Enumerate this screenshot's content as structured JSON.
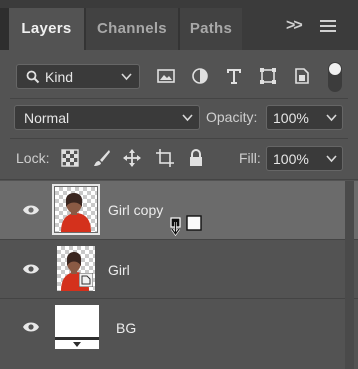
{
  "tabs": [
    {
      "label": "Layers",
      "active": true
    },
    {
      "label": "Channels",
      "active": false
    },
    {
      "label": "Paths",
      "active": false
    }
  ],
  "tabbar": {
    "overflow_icon": "double-chevron-right-icon",
    "menu_icon": "hamburger-menu-icon"
  },
  "filter": {
    "kind_label": "Kind",
    "icons": [
      "image-filter-icon",
      "adjustment-filter-icon",
      "type-filter-icon",
      "shape-filter-icon",
      "smart-object-filter-icon"
    ],
    "toggle_on": true
  },
  "blend": {
    "mode": "Normal",
    "opacity_label": "Opacity:",
    "opacity_value": "100%"
  },
  "lock": {
    "label": "Lock:",
    "icons": [
      "lock-transparent-pixels-icon",
      "lock-image-pixels-icon",
      "lock-position-icon",
      "lock-artboard-icon",
      "lock-all-icon"
    ],
    "fill_label": "Fill:",
    "fill_value": "100%"
  },
  "layers": [
    {
      "name": "Girl copy",
      "visible": true,
      "selected": true
    },
    {
      "name": "Girl",
      "visible": true,
      "selected": false
    },
    {
      "name": "BG",
      "visible": true,
      "selected": false
    }
  ],
  "colors": {
    "panel": "#535353",
    "selected_row": "#6b6b6b",
    "tabbar": "#3b3b3b",
    "subject_red": "#d4311c"
  }
}
